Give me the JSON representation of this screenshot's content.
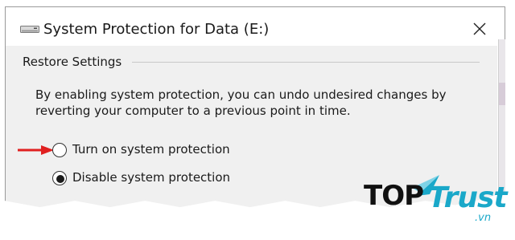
{
  "window": {
    "title": "System Protection for Data (E:)",
    "icon": "drive-icon",
    "close_icon": "close-icon"
  },
  "restore_settings": {
    "group_title": "Restore Settings",
    "description": "By enabling system protection, you can undo undesired changes by reverting your computer to a previous point in time.",
    "options": [
      {
        "label": "Turn on system protection",
        "selected": false
      },
      {
        "label": "Disable system protection",
        "selected": true
      }
    ]
  },
  "annotation": {
    "icon": "red-arrow-icon",
    "color": "#e02020"
  },
  "watermark": {
    "brand": "TOPTrust",
    "part1": "TOP",
    "part2": "Trust",
    "suffix": ".vn",
    "accent": "#1aa8c9"
  }
}
